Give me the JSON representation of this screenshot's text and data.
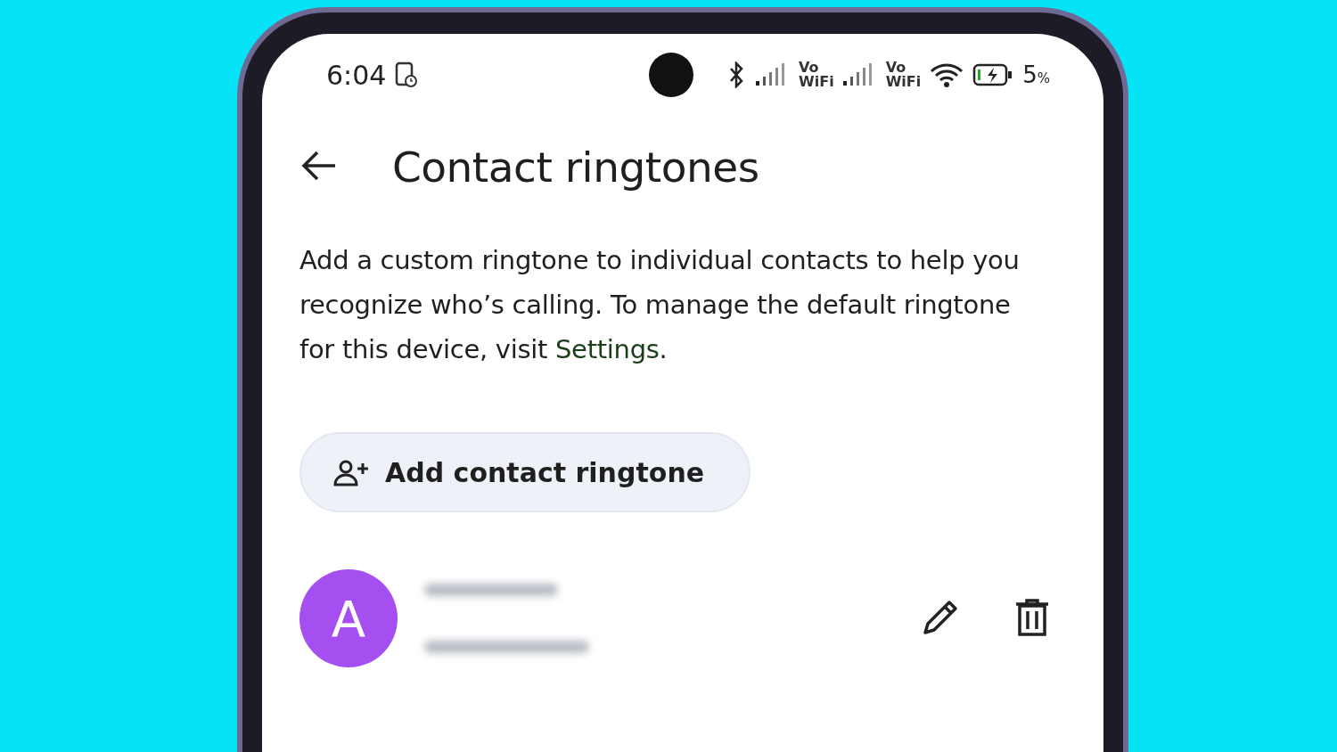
{
  "status_bar": {
    "time": "6:04",
    "vowifi": [
      {
        "top": "Vo",
        "bottom": "WiFi"
      },
      {
        "top": "Vo",
        "bottom": "WiFi"
      }
    ],
    "battery": "5",
    "battery_unit": "%"
  },
  "header": {
    "title": "Contact ringtones"
  },
  "description": {
    "text": "Add a custom ringtone to individual contacts to help you recognize who’s calling. To manage the default ringtone for this device, visit ",
    "link": "Settings",
    "end": "."
  },
  "add_button": {
    "label": "Add contact ringtone"
  },
  "contacts": [
    {
      "initial": "A",
      "color": "#a64ff0"
    }
  ]
}
